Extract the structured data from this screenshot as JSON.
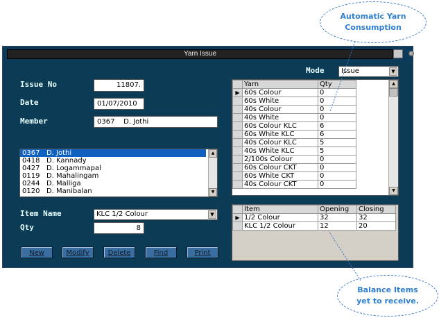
{
  "window": {
    "title": "Yarn Issue"
  },
  "mode": {
    "label": "Mode",
    "value": "Issue"
  },
  "form": {
    "issue_no_label": "Issue No",
    "issue_no_value": "11807.",
    "date_label": "Date",
    "date_value": "01/07/2010",
    "member_label": "Member",
    "member_value": "0367    D. Jothi",
    "item_name_label": "Item Name",
    "item_name_value": "KLC 1/2 Colour",
    "qty_label": "Qty",
    "qty_value": "8"
  },
  "member_list": [
    "0367   D. Jothi",
    "0418   D. Kannady",
    "0427   D. Logammapal",
    "0119   D. Mahalingam",
    "0244   D. Malliga",
    "0120   D. Manibalan"
  ],
  "buttons": {
    "new": "New",
    "modify": "Modify",
    "delete": "Delete",
    "find": "Find",
    "print": "Print"
  },
  "yarn_grid": {
    "headers": [
      "Yarn",
      "Qty"
    ],
    "rows": [
      [
        "60s Colour",
        "0"
      ],
      [
        "60s White",
        "0"
      ],
      [
        "40s Colour",
        "0"
      ],
      [
        "40s White",
        "0"
      ],
      [
        "60s Colour KLC",
        "6"
      ],
      [
        "60s White KLC",
        "6"
      ],
      [
        "40s Colour KLC",
        "5"
      ],
      [
        "40s White KLC",
        "5"
      ],
      [
        "2/100s Colour",
        "0"
      ],
      [
        "60s Colour CKT",
        "0"
      ],
      [
        "60s White CKT",
        "0"
      ],
      [
        "40s Colour CKT",
        "0"
      ]
    ]
  },
  "balance_grid": {
    "headers": [
      "Item",
      "Opening",
      "Closing"
    ],
    "rows": [
      [
        "1/2 Colour",
        "32",
        "32"
      ],
      [
        "KLC 1/2 Colour",
        "12",
        "20"
      ]
    ]
  },
  "callouts": {
    "yarn": "Automatic Yarn Consumption",
    "balance": "Balance Items yet to receive."
  }
}
